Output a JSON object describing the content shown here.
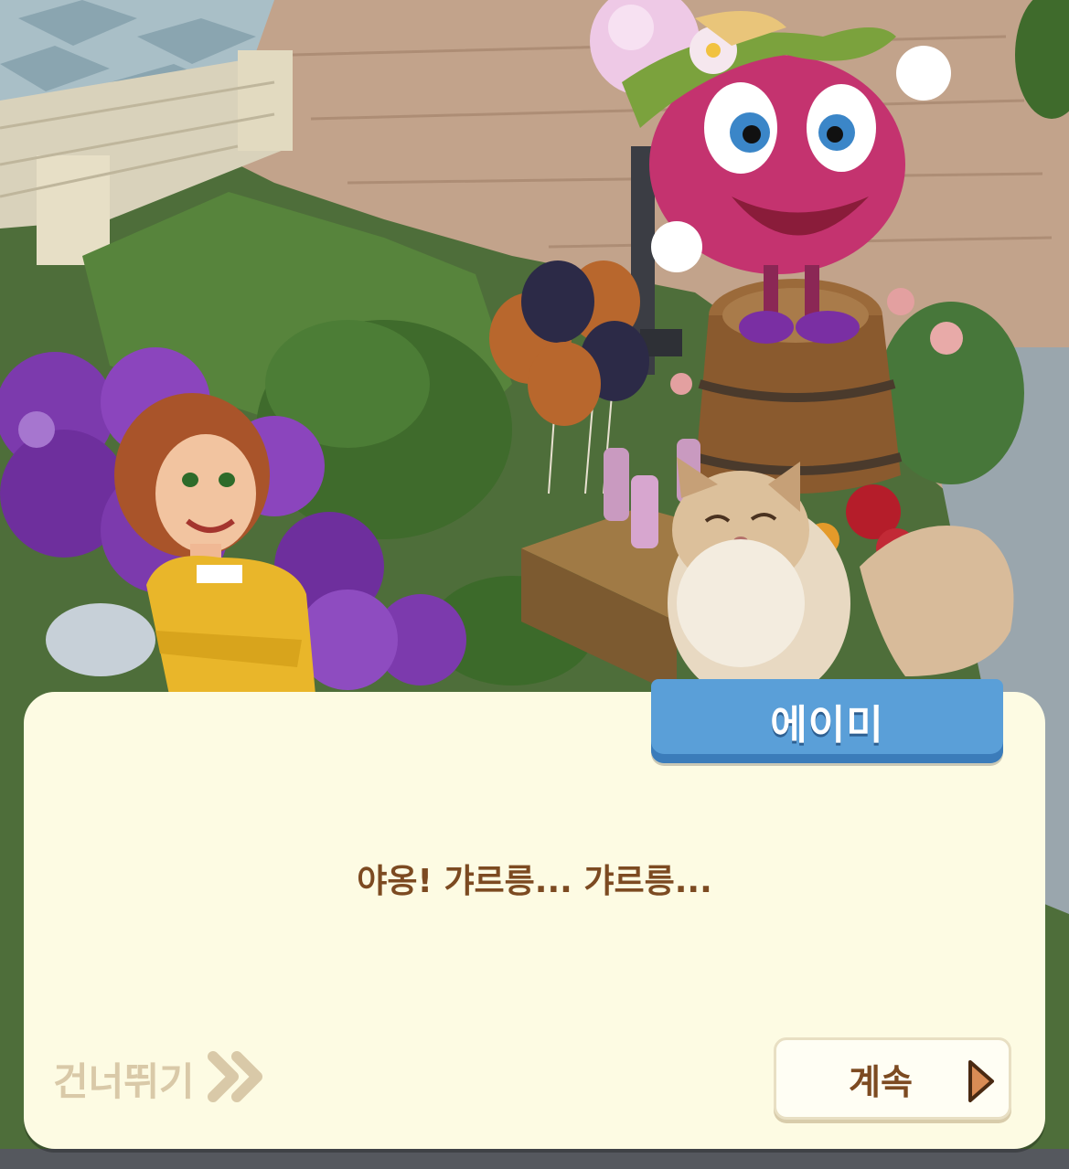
{
  "dialog": {
    "speaker": "에이미",
    "text": "야옹! 갸르릉... 갸르릉...",
    "skip_label": "건너뛰기",
    "continue_label": "계속"
  },
  "icons": {
    "skip": "double-chevron-right-icon",
    "continue": "play-triangle-icon"
  },
  "colors": {
    "dialog_bg": "#fdfbe3",
    "name_tag": "#5a9fd8",
    "text_brown": "#7c4a21",
    "skip_text": "#d9c9a8",
    "continue_arrow": "#d98c55"
  }
}
